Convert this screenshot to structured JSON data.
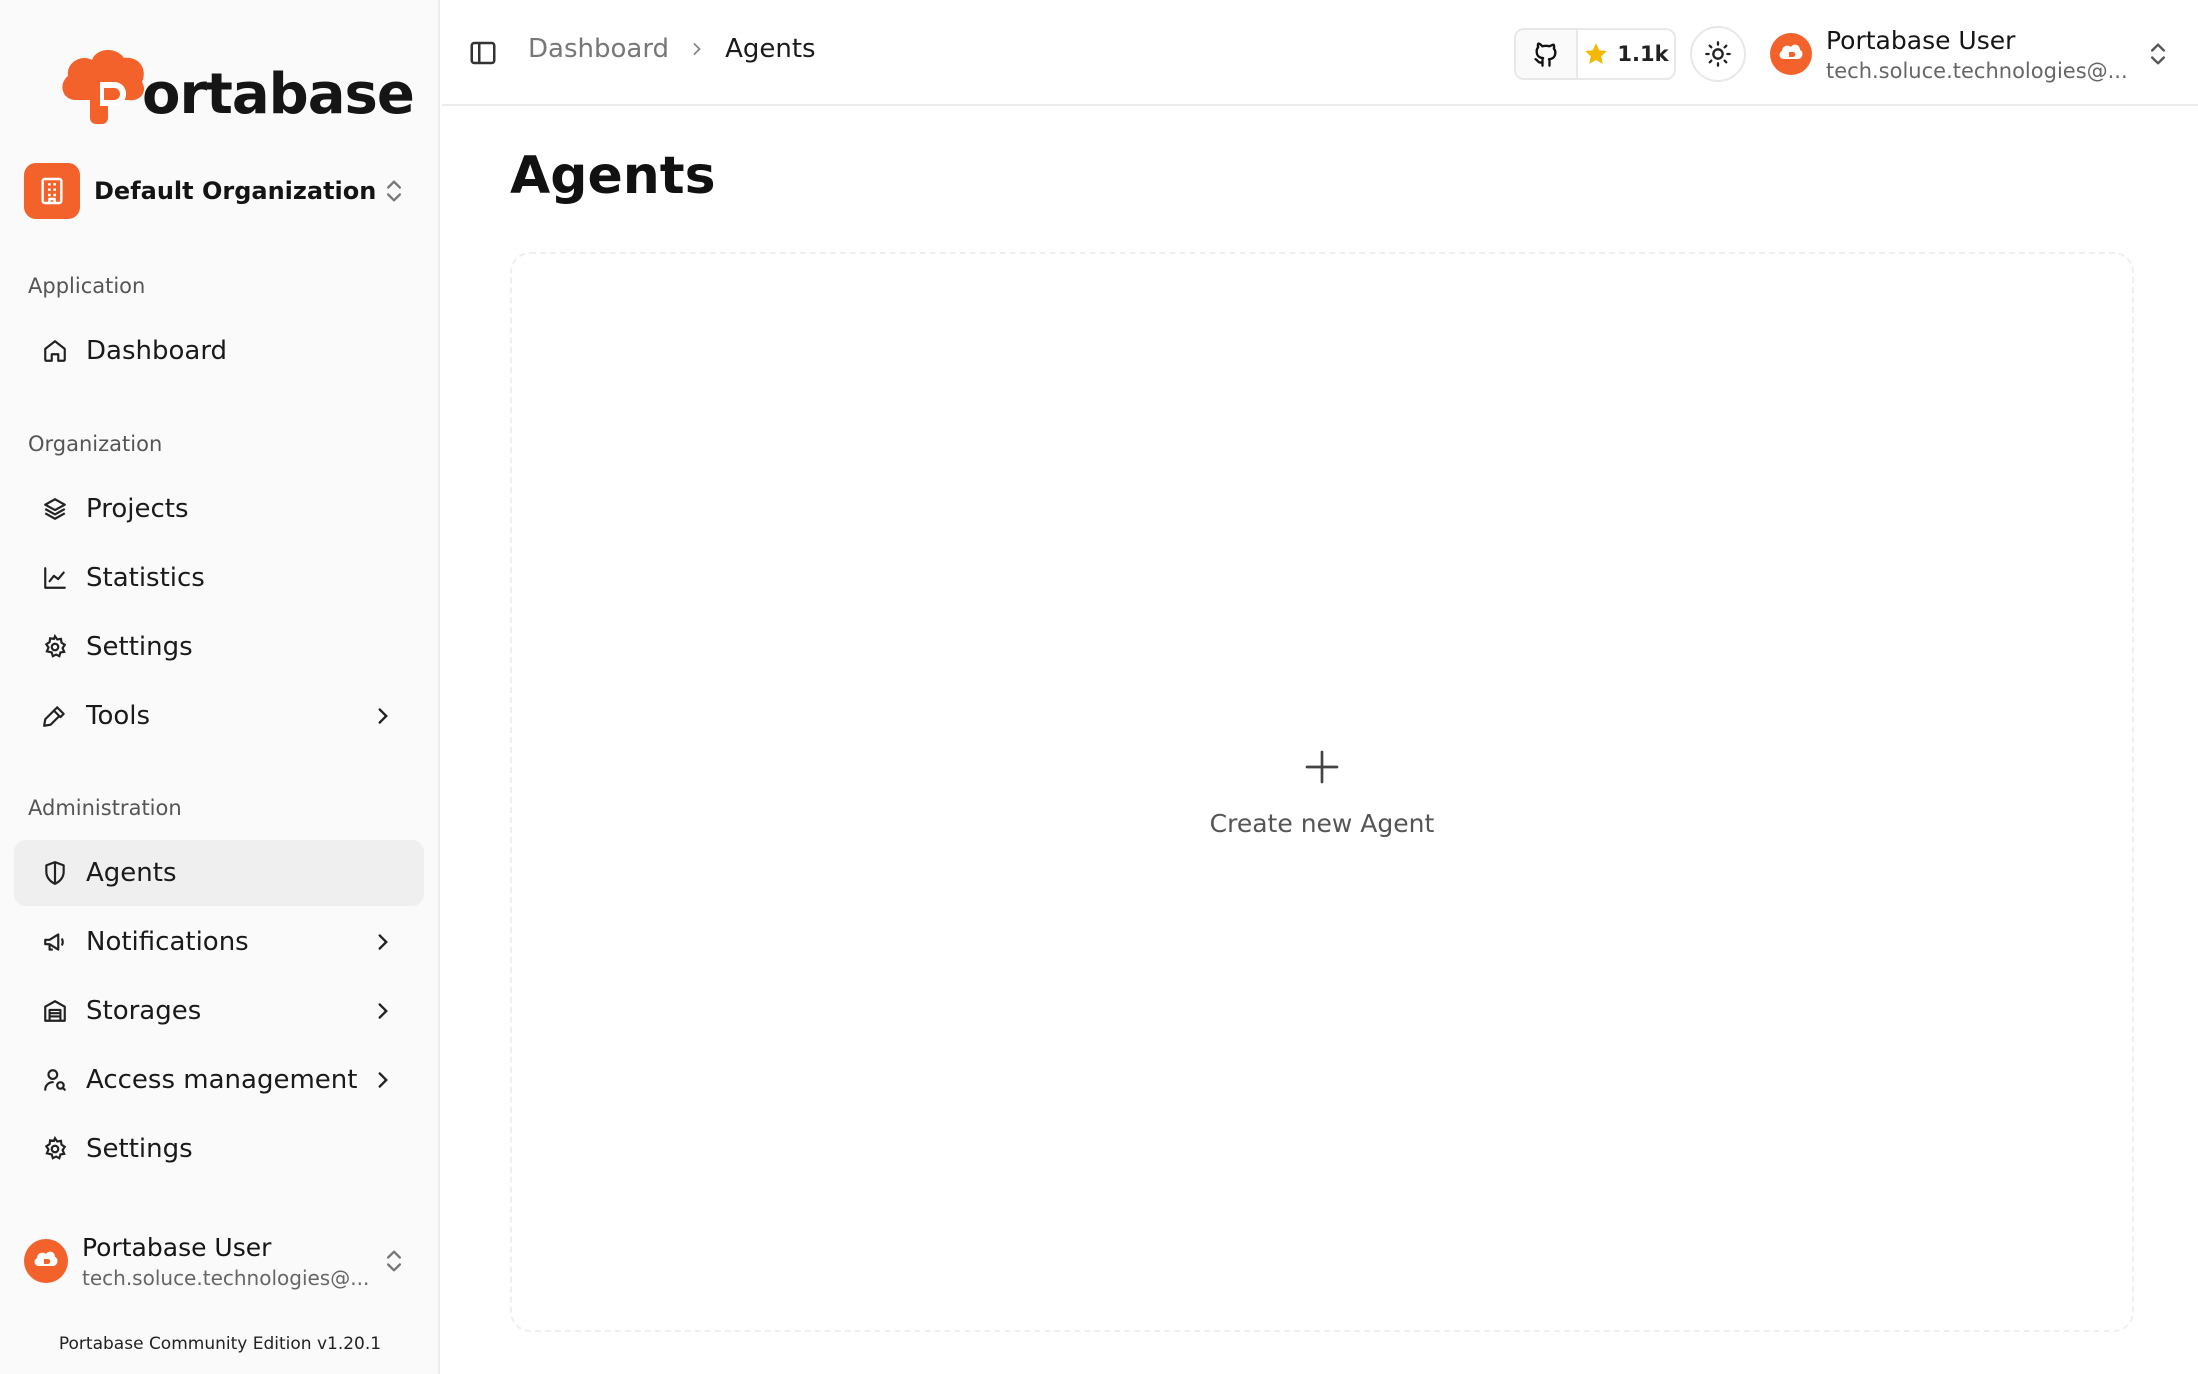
{
  "brand": {
    "name": "ortabase",
    "accent": "#f2622a"
  },
  "org": {
    "name": "Default Organization"
  },
  "sidebar": {
    "sections": [
      {
        "label": "Application"
      },
      {
        "label": "Organization"
      },
      {
        "label": "Administration"
      }
    ],
    "items": [
      {
        "label": "Dashboard",
        "icon": "home-icon"
      },
      {
        "label": "Projects",
        "icon": "layers-icon"
      },
      {
        "label": "Statistics",
        "icon": "chart-icon"
      },
      {
        "label": "Settings",
        "icon": "gear-icon"
      },
      {
        "label": "Tools",
        "icon": "hammer-icon",
        "expandable": true
      },
      {
        "label": "Agents",
        "icon": "shield-icon",
        "active": true
      },
      {
        "label": "Notifications",
        "icon": "megaphone-icon",
        "expandable": true
      },
      {
        "label": "Storages",
        "icon": "warehouse-icon",
        "expandable": true
      },
      {
        "label": "Access management",
        "icon": "user-key-icon",
        "expandable": true
      },
      {
        "label": "Settings",
        "icon": "gear-icon"
      }
    ],
    "user": {
      "name": "Portabase User",
      "email": "tech.soluce.technologies@..."
    },
    "edition": "Portabase Community Edition v1.20.1"
  },
  "header": {
    "breadcrumb": {
      "parent": "Dashboard",
      "current": "Agents"
    },
    "github_stars": "1.1k",
    "user": {
      "name": "Portabase User",
      "email": "tech.soluce.technologies@..."
    }
  },
  "main": {
    "title": "Agents",
    "create_label": "Create new Agent"
  }
}
